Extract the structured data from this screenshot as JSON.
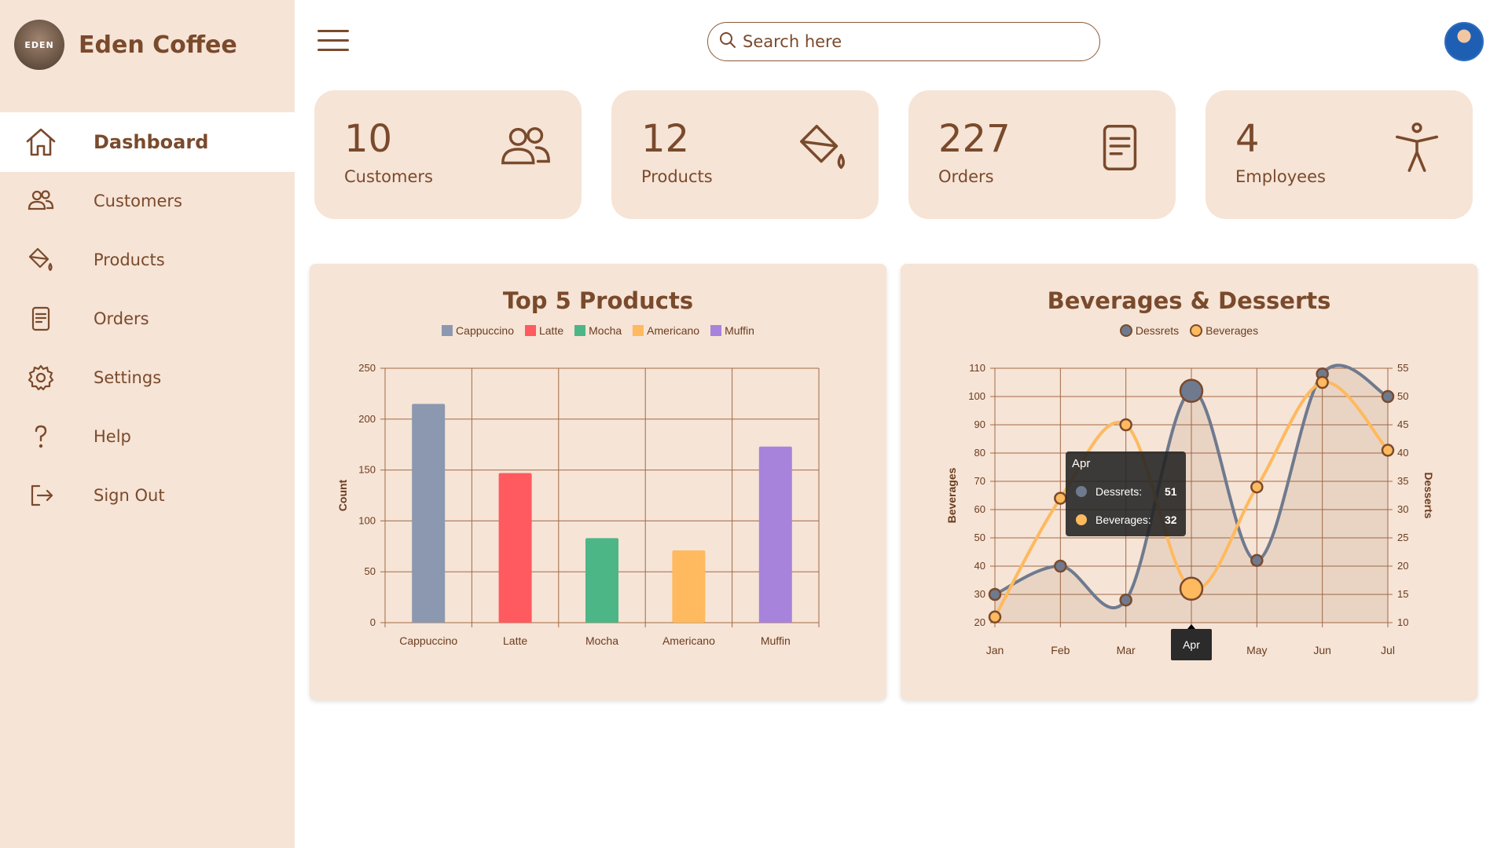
{
  "app": {
    "brand_name": "Eden Coffee",
    "logo_text": "EDEN"
  },
  "sidebar": {
    "items": [
      {
        "label": "Dashboard",
        "icon": "home-icon",
        "active": true
      },
      {
        "label": "Customers",
        "icon": "users-icon"
      },
      {
        "label": "Products",
        "icon": "paint-bucket-icon"
      },
      {
        "label": "Orders",
        "icon": "document-icon"
      },
      {
        "label": "Settings",
        "icon": "gear-icon"
      },
      {
        "label": "Help",
        "icon": "question-icon"
      },
      {
        "label": "Sign Out",
        "icon": "sign-out-icon"
      }
    ]
  },
  "header": {
    "search_placeholder": "Search here"
  },
  "stats": [
    {
      "value": "10",
      "label": "Customers",
      "icon": "users-icon"
    },
    {
      "value": "12",
      "label": "Products",
      "icon": "paint-bucket-icon"
    },
    {
      "value": "227",
      "label": "Orders",
      "icon": "document-icon"
    },
    {
      "value": "4",
      "label": "Employees",
      "icon": "accessibility-icon"
    }
  ],
  "colors": {
    "accent": "#7a4a2c",
    "card_bg": "#f6e4d6",
    "sidebar_bg": "#f6e4d6"
  },
  "chart_data": [
    {
      "type": "bar",
      "title": "Top 5 Products",
      "categories": [
        "Cappuccino",
        "Latte",
        "Mocha",
        "Americano",
        "Muffin"
      ],
      "values": [
        215,
        147,
        83,
        71,
        173
      ],
      "colors": [
        "#8c98b0",
        "#ff5a5f",
        "#4cb687",
        "#ffb95e",
        "#a883db"
      ],
      "ylabel": "Count",
      "ylim": [
        0,
        250
      ],
      "yticks": [
        0,
        50,
        100,
        150,
        200,
        250
      ],
      "legend": "top",
      "grid": true
    },
    {
      "type": "line",
      "title": "Beverages & Desserts",
      "x": [
        "Jan",
        "Feb",
        "Mar",
        "Apr",
        "May",
        "Jun",
        "Jul"
      ],
      "series": [
        {
          "name": "Dessrets",
          "values": [
            15,
            20,
            14,
            51,
            21,
            54,
            50
          ],
          "axis": "right",
          "color": "#6f7a8e",
          "fill": true
        },
        {
          "name": "Beverages",
          "values": [
            22,
            64,
            90,
            32,
            68,
            105,
            81
          ],
          "axis": "left",
          "color": "#ffb95e"
        }
      ],
      "ylabel_left": "Beverages",
      "ylabel_right": "Desserts",
      "ylim_left": [
        20,
        110
      ],
      "ylim_right": [
        10,
        55
      ],
      "yticks_left": [
        20,
        30,
        40,
        50,
        60,
        70,
        80,
        90,
        100,
        110
      ],
      "yticks_right": [
        10,
        15,
        20,
        25,
        30,
        35,
        40,
        45,
        50,
        55
      ],
      "legend": "top",
      "grid": true,
      "tooltip": {
        "title": "Apr",
        "rows": [
          {
            "label": "Dessrets:",
            "value": "51"
          },
          {
            "label": "Beverages:",
            "value": "32"
          }
        ]
      },
      "hover_label": "Apr"
    }
  ]
}
